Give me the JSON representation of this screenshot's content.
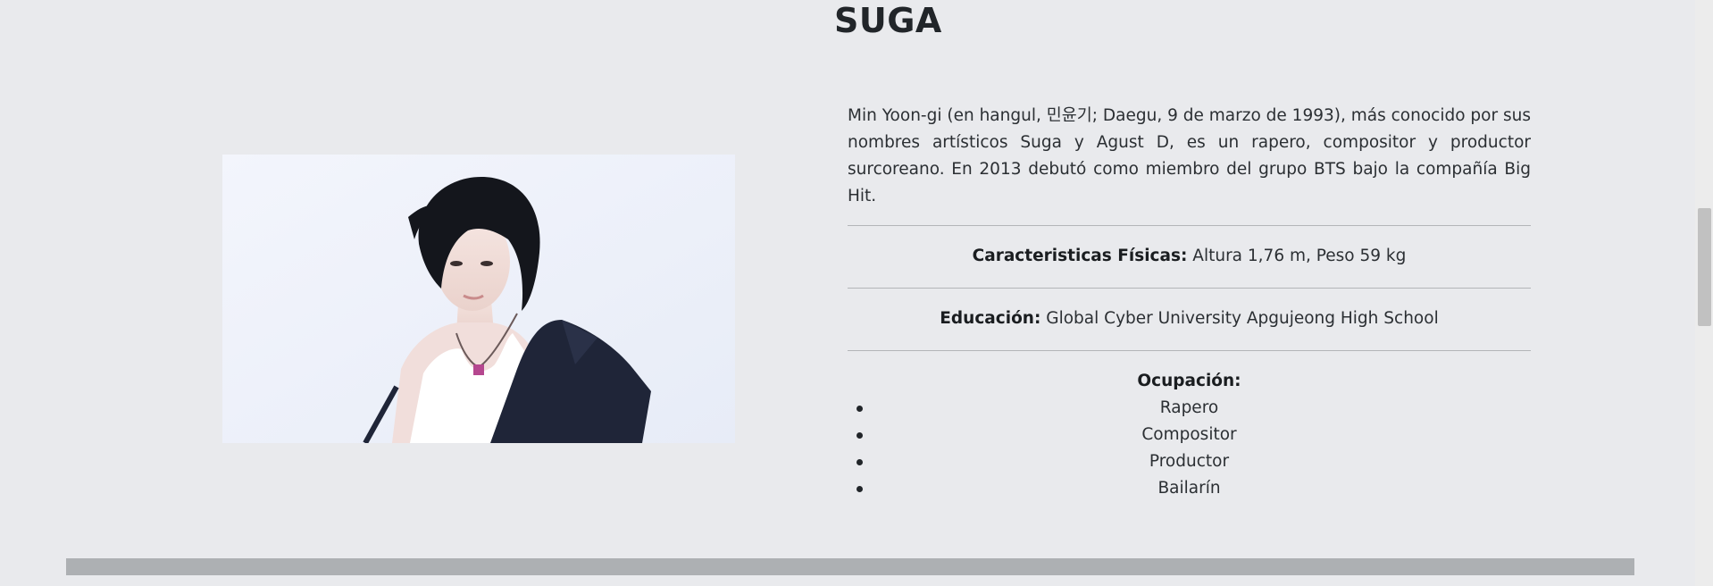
{
  "profile": {
    "name": "SUGA",
    "photo_alt": "SUGA",
    "intro": "Min Yoon-gi (en hangul, 민윤기; Daegu, 9 de marzo de 1993), más conocido por sus nombres artísticos Suga y Agust D, es un rapero, compositor y productor surcoreano. En 2013 debutó como miembro del grupo BTS bajo la compañía Big Hit.",
    "physical": {
      "label": "Caracteristicas Físicas:",
      "value": " Altura 1,76 m, Peso 59 kg"
    },
    "education": {
      "label": "Educación:",
      "value": " Global Cyber University Apgujeong High School"
    },
    "occupation": {
      "label": "Ocupación:",
      "items": [
        "Rapero",
        "Compositor",
        "Productor",
        "Bailarín"
      ]
    }
  },
  "colors": {
    "background": "#e9eaed",
    "text": "#212529",
    "divider": "#b3b5b8",
    "bottom_bar": "#adb0b3"
  }
}
